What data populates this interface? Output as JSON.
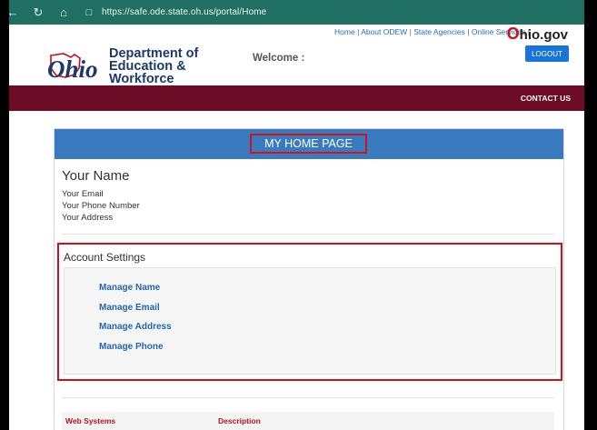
{
  "browser": {
    "url": "https://safe.ode.state.oh.us/portal/Home",
    "back_icon": "back-arrow-icon",
    "reload_icon": "reload-icon",
    "home_icon": "home-icon",
    "lock_icon": "lock-icon"
  },
  "top_nav": {
    "links": [
      "Home",
      "About ODEW",
      "State Agencies",
      "Online Services"
    ],
    "separator": "|"
  },
  "ohio_gov": {
    "o": "O",
    "rest": "hio.gov"
  },
  "header": {
    "dept_line1": "Department of",
    "dept_line2": "Education &",
    "dept_line3": "Workforce",
    "welcome": "Welcome :",
    "logout": "LOGOUT"
  },
  "maroon_nav": {
    "contact": "CONTACT US"
  },
  "main": {
    "title": "MY HOME PAGE",
    "profile": {
      "name": "Your Name",
      "email": "Your Email",
      "phone": "Your Phone Number",
      "address": "Your Address"
    },
    "account_settings": {
      "title": "Account Settings",
      "links": [
        "Manage Name",
        "Manage Email",
        "Manage Address",
        "Manage Phone"
      ]
    },
    "web_systems": {
      "columns": [
        "Web Systems",
        "Description"
      ]
    }
  },
  "colors": {
    "browser_bar": "#1f6f63",
    "maroon": "#6e0b26",
    "header_blue": "#3a7abe",
    "link_blue": "#2466b3",
    "highlight_red": "#c8141e"
  }
}
